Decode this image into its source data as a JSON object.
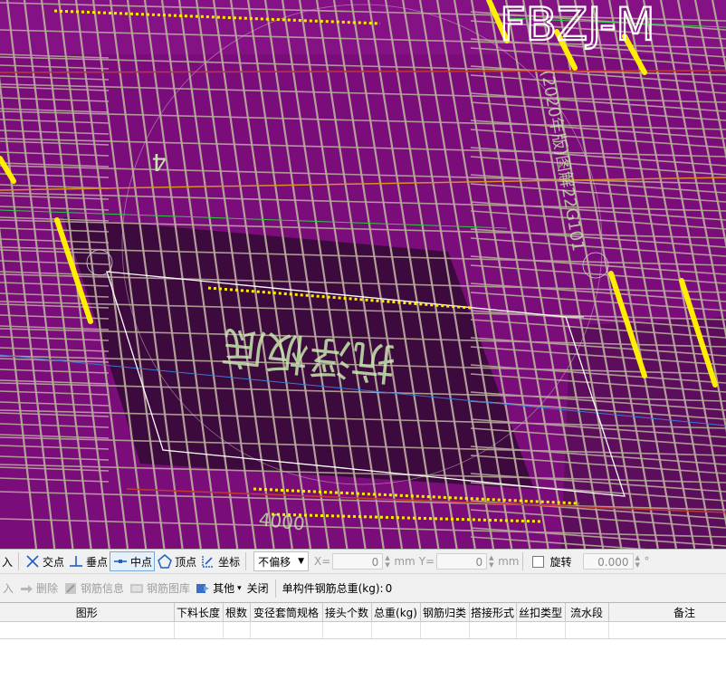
{
  "canvas": {
    "big_label": "FBZJ-M",
    "region_label": "抗浮板底",
    "axis_label": "4",
    "rotated_text": "(2020年版)图解22G101",
    "bottom_text": "4000"
  },
  "colors": {
    "background": "#7a0d7a",
    "inner_pit": "#3c0a3c",
    "rebar": "#b7a89b",
    "highlight": "#ffee00",
    "outline": "#ffffff"
  },
  "snap_toolbar": {
    "partial_label": "入",
    "intersection": "交点",
    "perpendicular": "垂点",
    "midpoint": "中点",
    "vertex": "顶点",
    "coordinate": "坐标",
    "offset_mode": "不偏移",
    "x_label": "X=",
    "x_value": "0",
    "x_unit": "mm",
    "y_label": "Y=",
    "y_value": "0",
    "y_unit": "mm",
    "rotate_label": "旋转",
    "rotate_value": "0.000",
    "degree": "°"
  },
  "rebar_toolbar": {
    "partial_label": "入",
    "delete": "删除",
    "rebar_info": "钢筋信息",
    "rebar_library": "钢筋图库",
    "other": "其他",
    "close": "关闭",
    "total_weight_label": "单构件钢筋总重(kg):",
    "total_weight_value": "0"
  },
  "table": {
    "columns": [
      "图形",
      "下料长度",
      "根数",
      "变径套筒规格",
      "接头个数",
      "总重(kg)",
      "钢筋归类",
      "搭接形式",
      "丝扣类型",
      "流水段",
      "备注"
    ],
    "rows": [
      [
        "",
        "",
        "",
        "",
        "",
        "",
        "",
        "",
        "",
        "",
        ""
      ]
    ]
  }
}
